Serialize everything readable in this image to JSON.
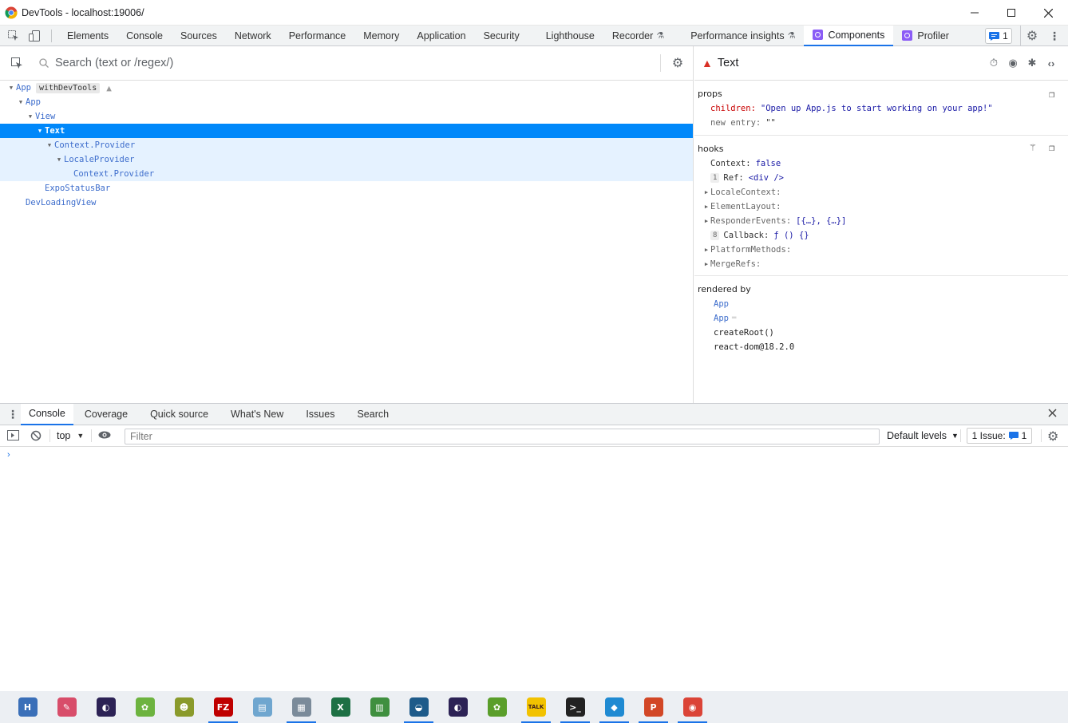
{
  "window": {
    "title": "DevTools - localhost:19006/"
  },
  "main_tabs": [
    {
      "label": "Elements"
    },
    {
      "label": "Console"
    },
    {
      "label": "Sources"
    },
    {
      "label": "Network"
    },
    {
      "label": "Performance"
    },
    {
      "label": "Memory"
    },
    {
      "label": "Application"
    },
    {
      "label": "Security"
    },
    {
      "label": "Lighthouse"
    },
    {
      "label": "Recorder"
    },
    {
      "label": "Performance insights"
    },
    {
      "label": "Components"
    },
    {
      "label": "Profiler"
    }
  ],
  "issue_count": "1",
  "components": {
    "search_placeholder": "Search (text or /regex/)",
    "tree": [
      {
        "name": "App",
        "hoc": "withDevTools",
        "warn": "▲"
      },
      {
        "name": "App"
      },
      {
        "name": "View"
      },
      {
        "name": "Text"
      },
      {
        "name": "Context.Provider"
      },
      {
        "name": "LocaleProvider"
      },
      {
        "name": "Context.Provider"
      },
      {
        "name": "ExpoStatusBar"
      },
      {
        "name": "DevLoadingView"
      }
    ],
    "inspected": {
      "name": "Text",
      "props_title": "props",
      "props": [
        {
          "key": "children:",
          "value": "\"Open up App.js to start working on your app!\""
        },
        {
          "key": "new entry:",
          "value": "\"\""
        }
      ],
      "hooks_title": "hooks",
      "hooks": [
        {
          "key": "Context:",
          "value": "false"
        },
        {
          "badge": "1",
          "key": "Ref:",
          "value": "<div />"
        },
        {
          "key": "LocaleContext:",
          "value": ""
        },
        {
          "key": "ElementLayout:",
          "value": ""
        },
        {
          "key": "ResponderEvents:",
          "value": "[{…}, {…}]"
        },
        {
          "badge": "8",
          "key": "Callback:",
          "value": "ƒ () {}"
        },
        {
          "key": "PlatformMethods:",
          "value": ""
        },
        {
          "key": "MergeRefs:",
          "value": ""
        }
      ],
      "rendered_title": "rendered by",
      "rendered_by": [
        {
          "label": "App"
        },
        {
          "label": "App",
          "suffix": "═"
        },
        {
          "label": "createRoot()"
        },
        {
          "label": "react-dom@18.2.0"
        }
      ]
    }
  },
  "drawer_tabs": [
    {
      "label": "Console"
    },
    {
      "label": "Coverage"
    },
    {
      "label": "Quick source"
    },
    {
      "label": "What's New"
    },
    {
      "label": "Issues"
    },
    {
      "label": "Search"
    }
  ],
  "console": {
    "context": "top",
    "filter_placeholder": "Filter",
    "levels": "Default levels",
    "issues_label": "1 Issue:",
    "issues_count": "1",
    "prompt": "›"
  },
  "taskbar": [
    {
      "icon": "h-app-icon",
      "letter": "H",
      "color": "#3a6fb8"
    },
    {
      "icon": "paint-icon",
      "letter": "✎",
      "color": "#d84d6a"
    },
    {
      "icon": "eclipse-icon",
      "letter": "◐",
      "color": "#2c2255"
    },
    {
      "icon": "spring-icon",
      "letter": "✿",
      "color": "#6db33f"
    },
    {
      "icon": "toad-icon",
      "letter": "☻",
      "color": "#8a9a2b"
    },
    {
      "icon": "filezilla-icon",
      "letter": "FZ",
      "color": "#bf0000"
    },
    {
      "icon": "notepad-icon",
      "letter": "▤",
      "color": "#6fa6cf"
    },
    {
      "icon": "explorer-icon",
      "letter": "▦",
      "color": "#7b8b9a"
    },
    {
      "icon": "excel-icon",
      "letter": "X",
      "color": "#1d7044"
    },
    {
      "icon": "chart-app-icon",
      "letter": "▥",
      "color": "#3f8f3f"
    },
    {
      "icon": "mysql-icon",
      "letter": "◒",
      "color": "#1e5b8a"
    },
    {
      "icon": "eclipse-icon-2",
      "letter": "◐",
      "color": "#2c2255"
    },
    {
      "icon": "sts-icon",
      "letter": "✿",
      "color": "#5a9e2a"
    },
    {
      "icon": "kakaotalk-icon",
      "letter": "TALK",
      "color": "#f2c200"
    },
    {
      "icon": "terminal-icon",
      "letter": ">_",
      "color": "#222222"
    },
    {
      "icon": "vscode-icon",
      "letter": "◆",
      "color": "#1f8ad2"
    },
    {
      "icon": "powerpoint-icon",
      "letter": "P",
      "color": "#d24726"
    },
    {
      "icon": "chrome-icon",
      "letter": "◉",
      "color": "#db4437"
    }
  ]
}
